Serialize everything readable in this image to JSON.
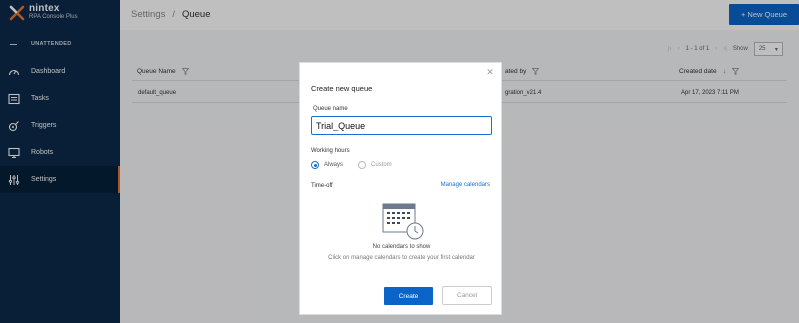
{
  "brand": {
    "name": "nintex",
    "product": "RPA Console Plus"
  },
  "sidebar": {
    "section_label": "UNATTENDED",
    "items": [
      {
        "label": "Dashboard",
        "icon": "dashboard-icon"
      },
      {
        "label": "Tasks",
        "icon": "tasks-icon"
      },
      {
        "label": "Triggers",
        "icon": "triggers-icon"
      },
      {
        "label": "Robots",
        "icon": "robots-icon"
      },
      {
        "label": "Settings",
        "icon": "settings-icon",
        "active": true
      }
    ]
  },
  "header": {
    "breadcrumb": [
      "Settings",
      "/",
      "Queue"
    ],
    "new_button": "+ New Queue"
  },
  "table": {
    "pager_text": "1 - 1 of 1",
    "show_label": "Show",
    "page_size": "25",
    "columns": [
      "Queue Name",
      "ated by",
      "Created date"
    ],
    "rows": [
      {
        "queue_name": "default_queue",
        "created_by": "gration_v21.4",
        "created_date": "Apr 17, 2023 7:11 PM"
      }
    ]
  },
  "modal": {
    "title": "Create new queue",
    "queue_name_label": "Queue name",
    "queue_name_value": "Trial_Queue",
    "working_hours_label": "Working hours",
    "option_always": "Always",
    "option_custom": "Custom",
    "selected_option": "Always",
    "timeoff_label": "Time-off",
    "manage_link": "Manage calendars",
    "empty_title": "No calendars to show",
    "empty_sub": "Click on manage calendars to create your first calendar",
    "create_label": "Create",
    "cancel_label": "Cancel"
  },
  "colors": {
    "sidebar": "#0b2a4a",
    "accent": "#0b64c8",
    "active_marker": "#e8742b"
  }
}
